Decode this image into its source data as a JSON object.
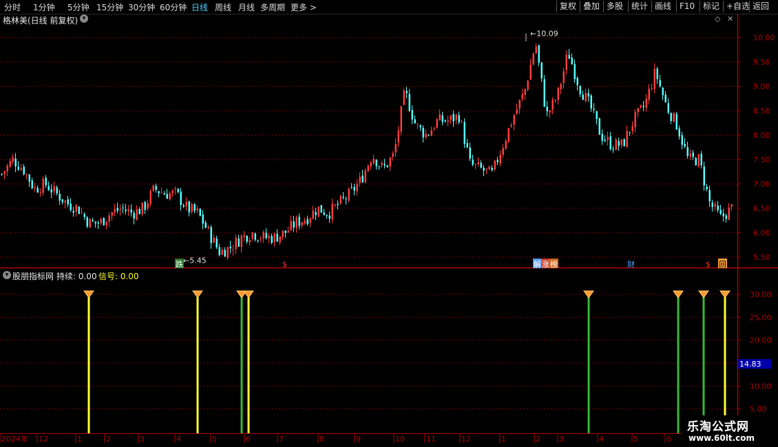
{
  "toolbar": {
    "tabs": [
      "分时",
      "1分钟",
      "5分钟",
      "15分钟",
      "30分钟",
      "60分钟",
      "日线",
      "周线",
      "月线",
      "多周期",
      "更多 >"
    ],
    "active_tab": "日线",
    "buttons": [
      "复权",
      "叠加",
      "多股",
      "统计",
      "画线",
      "F10",
      "标记",
      "+自选",
      "返回"
    ]
  },
  "main_header": {
    "title": "格林美(日线 前复权)"
  },
  "indicator_header": {
    "name": "股朋指标网",
    "hold_label": "持续: 0.00",
    "signal_label": "信号: 0.00"
  },
  "markers": {
    "high_label": "10.09",
    "low_label": "5.45",
    "event_tags": [
      "跌",
      "$",
      "解",
      "涨",
      "榜",
      "财",
      "$",
      "回"
    ]
  },
  "current_value": "14.83",
  "watermark": {
    "line1": "乐淘公式网",
    "line2": "www.60lt.com"
  },
  "colors": {
    "up": "#ff3c3c",
    "down": "#54ffff",
    "axis": "#b40000",
    "grid": "#7a0000",
    "yellow": "#ffff33",
    "green": "#33bb33"
  },
  "chart_data": [
    {
      "type": "candlestick",
      "title": "格林美(日线 前复权)",
      "ylim": [
        5.3,
        10.25
      ],
      "y_ticks": [
        "10.00",
        "9.50",
        "9.00",
        "8.50",
        "8.00",
        "7.50",
        "7.00",
        "6.50",
        "6.00",
        "5.50"
      ],
      "x_ticks": [
        "2024年",
        "12",
        "1",
        "2",
        "3",
        "4",
        "5",
        "6",
        "7",
        "8",
        "9",
        "10",
        "11",
        "12",
        "1",
        "2",
        "3",
        "4",
        "5",
        "6"
      ],
      "close_path": [
        7.2,
        7.5,
        7.3,
        6.9,
        7.0,
        6.8,
        6.6,
        6.5,
        6.2,
        6.2,
        6.4,
        6.5,
        6.4,
        6.5,
        6.9,
        6.8,
        6.8,
        6.5,
        6.4,
        6.0,
        5.6,
        5.7,
        5.9,
        6.0,
        5.9,
        5.9,
        6.0,
        6.2,
        6.3,
        6.5,
        6.4,
        6.6,
        6.8,
        7.1,
        7.6,
        7.3,
        7.6,
        8.9,
        8.2,
        8.0,
        8.3,
        8.3,
        8.4,
        7.4,
        7.3,
        7.2,
        7.8,
        8.4,
        8.9,
        9.9,
        8.4,
        8.8,
        9.7,
        9.0,
        8.6,
        8.0,
        7.8,
        7.8,
        8.3,
        8.6,
        9.3,
        8.6,
        8.2,
        7.5,
        7.5,
        6.6,
        6.3,
        6.5
      ],
      "high": 10.09,
      "low": 5.45
    },
    {
      "type": "bar",
      "title": "股朋指标网",
      "ylim": [
        0,
        33
      ],
      "y_ticks": [
        "30.00",
        "25.00",
        "20.00",
        "15.00",
        "10.00",
        "5.00"
      ],
      "signals": [
        {
          "color": "yellow",
          "value": 30
        },
        {
          "color": "yellow",
          "value": 30
        },
        {
          "color": "green",
          "value": 30
        },
        {
          "color": "yellow",
          "value": 30
        },
        {
          "color": "green",
          "value": 30
        },
        {
          "color": "green",
          "value": 30
        },
        {
          "color": "green",
          "value": 30
        },
        {
          "color": "yellow",
          "value": 30
        }
      ]
    }
  ]
}
